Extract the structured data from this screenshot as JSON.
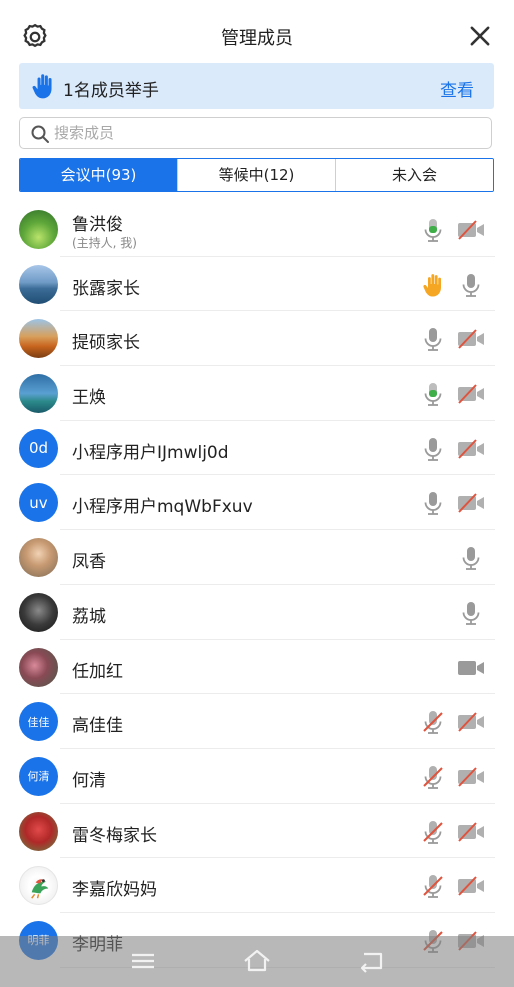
{
  "header": {
    "title": "管理成员",
    "settings_icon": "gear-icon",
    "close_icon": "close-icon"
  },
  "banner": {
    "text": "1名成员举手",
    "action": "查看",
    "icon": "raise-hand-icon"
  },
  "search": {
    "placeholder": "搜索成员",
    "value": ""
  },
  "tabs": [
    {
      "label": "会议中(93)",
      "active": true
    },
    {
      "label": "等候中(12)",
      "active": false
    },
    {
      "label": "未入会",
      "active": false
    }
  ],
  "members": [
    {
      "name": "鲁洪俊",
      "sub": "(主持人, 我)",
      "avatar": "photo-green",
      "mic": "active",
      "cam": "off"
    },
    {
      "name": "张露家长",
      "avatar": "photo-lake",
      "hand": true,
      "mic": "idle"
    },
    {
      "name": "提硕家长",
      "avatar": "photo-autumn",
      "mic": "idle",
      "cam": "off"
    },
    {
      "name": "王焕",
      "avatar": "photo-sea",
      "mic": "active",
      "cam": "off"
    },
    {
      "name": "小程序用户IJmwlj0d",
      "avatar_text": "0d",
      "mic": "idle",
      "cam": "off"
    },
    {
      "name": "小程序用户mqWbFxuv",
      "avatar_text": "uv",
      "mic": "idle",
      "cam": "off"
    },
    {
      "name": "凤香",
      "avatar": "photo-person",
      "mic": "idle"
    },
    {
      "name": "荔城",
      "avatar": "photo-dark",
      "mic": "idle"
    },
    {
      "name": "任加红",
      "avatar": "photo-flowers",
      "cam": "on"
    },
    {
      "name": "高佳佳",
      "avatar_text": "佳佳",
      "mic": "muted",
      "cam": "off"
    },
    {
      "name": "何清",
      "avatar_text": "何清",
      "mic": "muted",
      "cam": "off"
    },
    {
      "name": "雷冬梅家长",
      "avatar": "photo-red",
      "mic": "muted",
      "cam": "off"
    },
    {
      "name": "李嘉欣妈妈",
      "avatar": "photo-bird",
      "mic": "muted",
      "cam": "off"
    },
    {
      "name": "李明菲",
      "avatar_text": "明菲",
      "mic": "muted",
      "cam": "off"
    }
  ],
  "navbar": {
    "icons": [
      "menu-icon",
      "home-icon",
      "back-icon"
    ]
  },
  "colors": {
    "accent": "#1a73e8",
    "mic_active": "#3fae49",
    "muted_red": "#e0533d",
    "hand": "#f5a623",
    "icon_gray": "#9a9a9a"
  }
}
